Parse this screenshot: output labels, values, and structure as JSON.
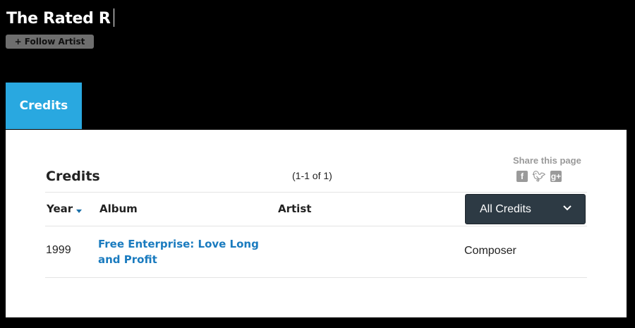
{
  "artist": {
    "name": "The Rated R"
  },
  "follow_button": {
    "label": "+ Follow Artist"
  },
  "tabs": [
    {
      "label": "Credits",
      "active": true
    }
  ],
  "credits": {
    "title": "Credits",
    "count_text": "(1-1 of 1)",
    "share": {
      "label": "Share this page",
      "icons": [
        "facebook-icon",
        "twitter-icon",
        "google-plus-icon"
      ]
    },
    "columns": {
      "year": "Year",
      "album": "Album",
      "artist": "Artist"
    },
    "sort": {
      "column": "Year",
      "direction": "descending"
    },
    "filter": {
      "selected": "All Credits"
    },
    "rows": [
      {
        "year": "1999",
        "album": "Free Enterprise: Love Long and Profit",
        "artist": "",
        "credit": "Composer"
      }
    ]
  },
  "colors": {
    "tab_active": "#29a8e0",
    "link": "#1a7bbf",
    "filter_bg": "#2d3a44",
    "follow_bg": "#6e6e6e",
    "share_icon": "#9a9a9a"
  }
}
